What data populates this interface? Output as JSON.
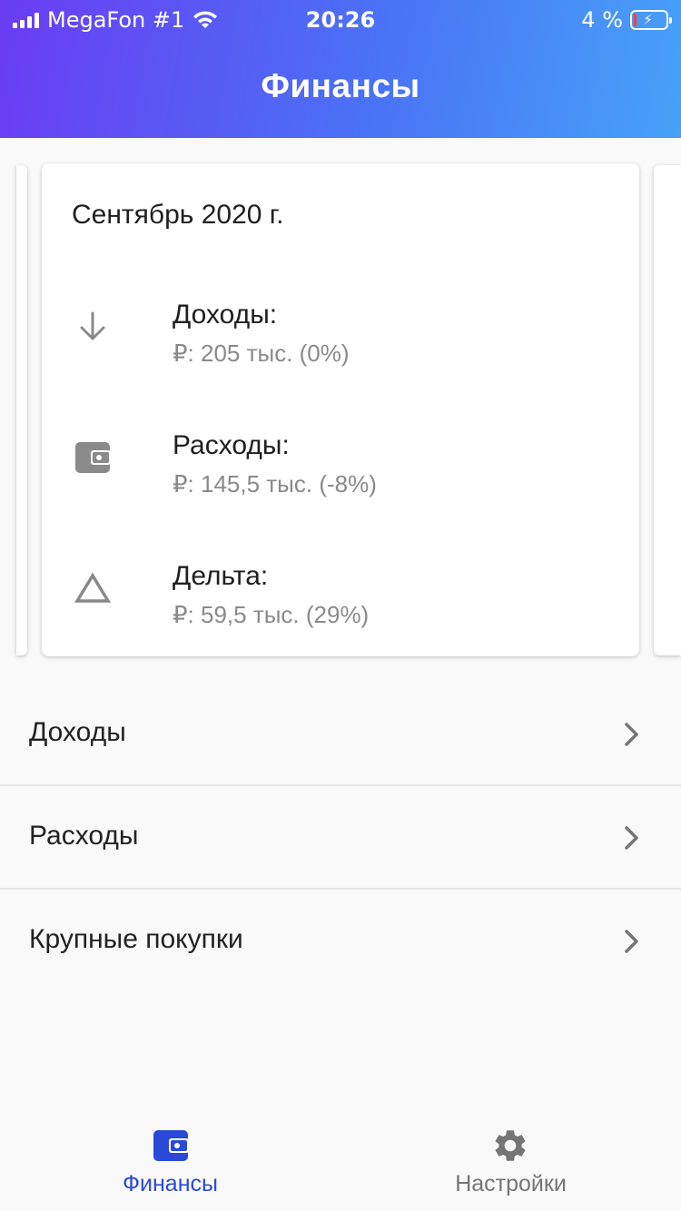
{
  "status_bar": {
    "carrier": "MegaFon #1",
    "time": "20:26",
    "battery": "4 %"
  },
  "header": {
    "title": "Финансы"
  },
  "summary_card": {
    "period": "Сентябрь 2020 г.",
    "stats": [
      {
        "icon": "arrow-down-icon",
        "label": "Доходы:",
        "value": "₽: 205 тыс. (0%)"
      },
      {
        "icon": "wallet-icon",
        "label": "Расходы:",
        "value": "₽: 145,5 тыс. (-8%)"
      },
      {
        "icon": "triangle-icon",
        "label": "Дельта:",
        "value": "₽: 59,5 тыс. (29%)"
      }
    ]
  },
  "menu": {
    "items": [
      {
        "label": "Доходы",
        "icon": "chevron-right-icon"
      },
      {
        "label": "Расходы",
        "icon": "chevron-right-icon"
      },
      {
        "label": "Крупные покупки",
        "icon": "chevron-right-icon"
      }
    ]
  },
  "bottom_nav": {
    "items": [
      {
        "label": "Финансы",
        "icon": "wallet-icon",
        "active": true
      },
      {
        "label": "Настройки",
        "icon": "gear-icon",
        "active": false
      }
    ]
  },
  "colors": {
    "header_gradient_start": "#6a3cf3",
    "header_gradient_end": "#47a2f8",
    "accent": "#2a49d8",
    "icon_gray": "#8a8a8a",
    "battery_low": "#ff3b30"
  }
}
